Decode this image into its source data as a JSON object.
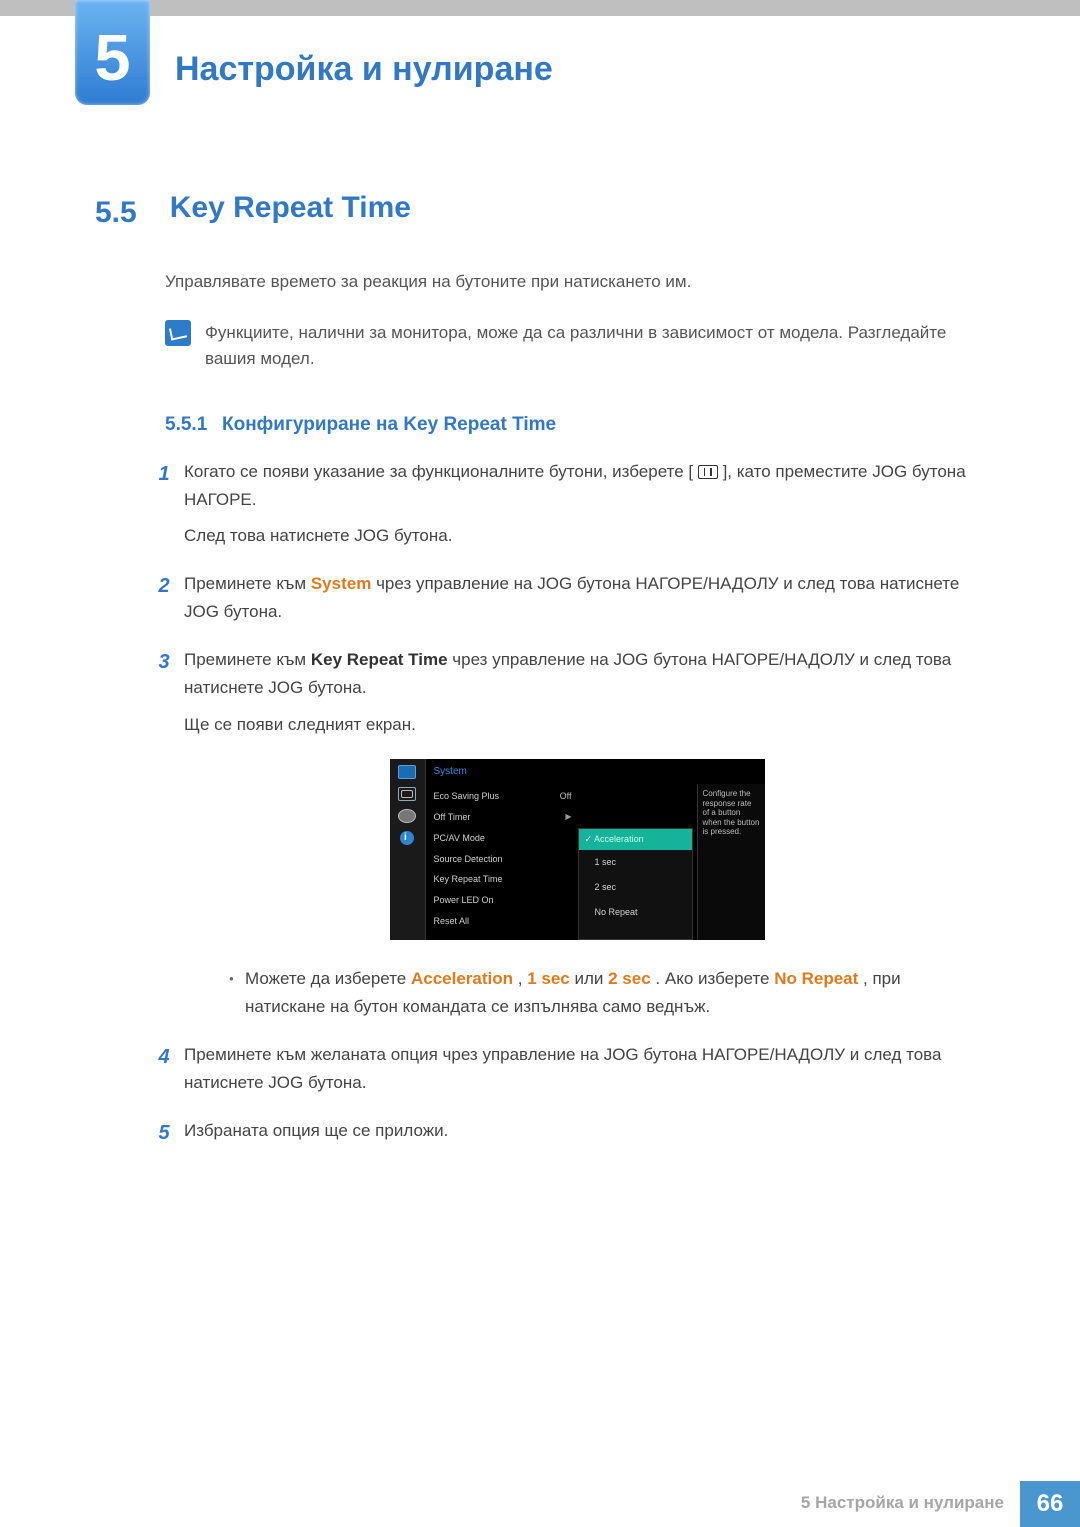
{
  "chapter": {
    "number": "5",
    "title": "Настройка и нулиране"
  },
  "section": {
    "number": "5.5",
    "title": "Key Repeat Time"
  },
  "intro": "Управлявате времето за реакция на бутоните при натискането им.",
  "note": "Функциите, налични за монитора, може да са различни в зависимост от модела. Разгледайте вашия модел.",
  "subsection": {
    "number": "5.5.1",
    "title": "Конфигуриране на Key Repeat Time"
  },
  "steps": {
    "s1a": "Когато се появи указание за функционалните бутони, изберете [",
    "s1b": "], като преместите JOG бутона НАГОРЕ.",
    "s1c": "След това натиснете JOG бутона.",
    "sys_pre": "Преминете към ",
    "sys_word": "System",
    "sys_post": " чрез управление на JOG бутона НАГОРЕ/НАДОЛУ и след това натиснете JOG бутона.",
    "krt_pre": "Преминете към ",
    "krt_word": "Key Repeat Time",
    "krt_post": " чрез управление на JOG бутона НАГОРЕ/НАДОЛУ и след това натиснете JOG бутона.",
    "screen_note": "Ще се появи следният екран.",
    "bullet_pre": "Можете да изберете ",
    "accel": "Acceleration",
    "comma1": ", ",
    "one_sec": "1 sec",
    "or": " или ",
    "two_sec": "2 sec",
    "after": ". Ако изберете ",
    "norepeat": "No Repeat",
    "tail": ", при натискане на бутон командата се изпълнява само веднъж.",
    "s4": "Преминете към желаната опция чрез управление на JOG бутона НАГОРЕ/НАДОЛУ и след това натиснете JOG бутона.",
    "s5": "Избраната опция ще се приложи."
  },
  "nums": {
    "n1": "1",
    "n2": "2",
    "n3": "3",
    "n4": "4",
    "n5": "5"
  },
  "osd": {
    "head": "System",
    "items": {
      "eco": "Eco Saving Plus",
      "eco_v": "Off",
      "off_timer": "Off Timer",
      "pcav": "PC/AV Mode",
      "srcdet": "Source Detection",
      "krt": "Key Repeat Time",
      "pled": "Power LED On",
      "reset": "Reset All"
    },
    "popup": {
      "sel": "Acceleration",
      "o1": "1 sec",
      "o2": "2 sec",
      "o3": "No Repeat"
    },
    "help": "Configure the response rate of a button when the button is pressed."
  },
  "footer": {
    "text": "5 Настройка и нулиране",
    "page": "66"
  }
}
